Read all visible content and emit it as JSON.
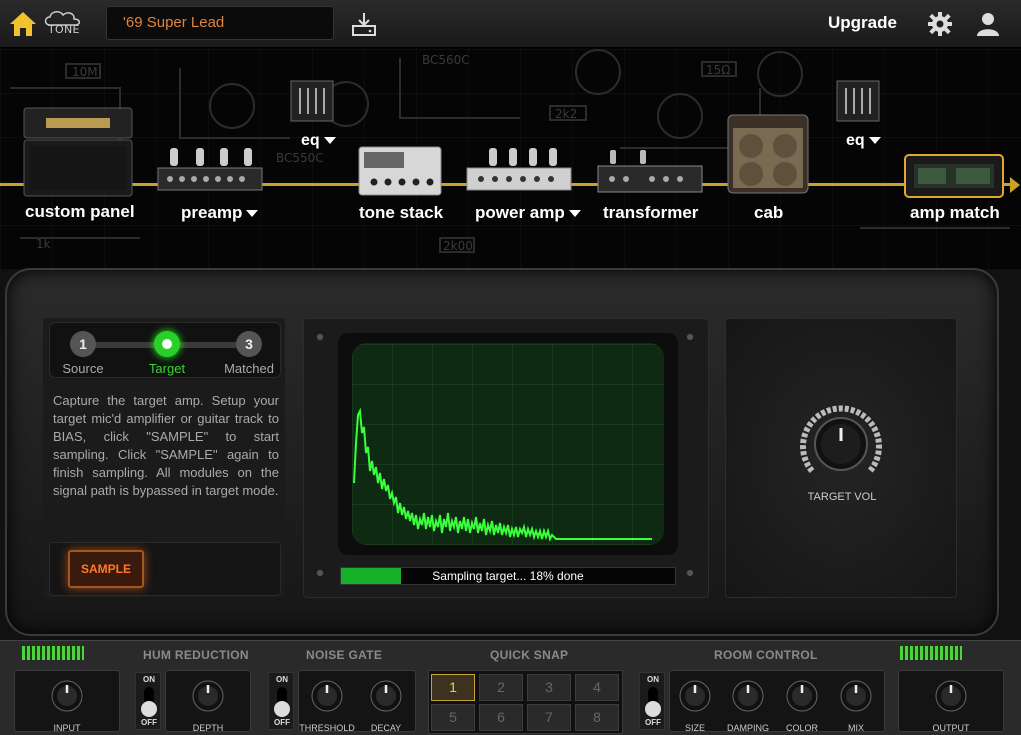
{
  "topbar": {
    "preset_name": "'69 Super Lead",
    "tone_label": "TONE",
    "upgrade_label": "Upgrade"
  },
  "chain": {
    "modules": [
      {
        "label": "custom panel"
      },
      {
        "label": "preamp"
      },
      {
        "label": "tone stack"
      },
      {
        "label": "power amp"
      },
      {
        "label": "transformer"
      },
      {
        "label": "cab"
      },
      {
        "label": "amp match"
      }
    ],
    "eq_left": "eq",
    "eq_right": "eq",
    "signal_color": "#c9a227"
  },
  "match": {
    "steps": [
      {
        "num": "1",
        "label": "Source"
      },
      {
        "num": "",
        "label": "Target"
      },
      {
        "num": "3",
        "label": "Matched"
      }
    ],
    "active_step": 2,
    "instructions": "Capture the target amp. Setup your target mic'd amplifier or guitar track to BIAS, click \"SAMPLE\" to start sampling. Click \"SAMPLE\" again to finish sampling. All modules on the signal path is bypassed in target mode.",
    "sample_label": "SAMPLE",
    "progress_text": "Sampling target... 18% done",
    "progress_percent": 18,
    "target_vol_label": "TARGET VOL"
  },
  "bottom": {
    "sections": {
      "hum": "HUM REDUCTION",
      "gate": "NOISE GATE",
      "snap": "QUICK SNAP",
      "room": "ROOM CONTROL"
    },
    "knobs": {
      "input": "INPUT",
      "depth": "DEPTH",
      "threshold": "THRESHOLD",
      "decay": "DECAY",
      "size": "SIZE",
      "damping": "DAMPING",
      "color": "COLOR",
      "mix": "MIX",
      "output": "OUTPUT"
    },
    "toggle_on": "ON",
    "toggle_off": "OFF",
    "snaps": [
      "1",
      "2",
      "3",
      "4",
      "5",
      "6",
      "7",
      "8"
    ],
    "active_snap": "1"
  },
  "colors": {
    "accent": "#c9a227",
    "green": "#2ad02a",
    "orange": "#ff7a2a"
  }
}
